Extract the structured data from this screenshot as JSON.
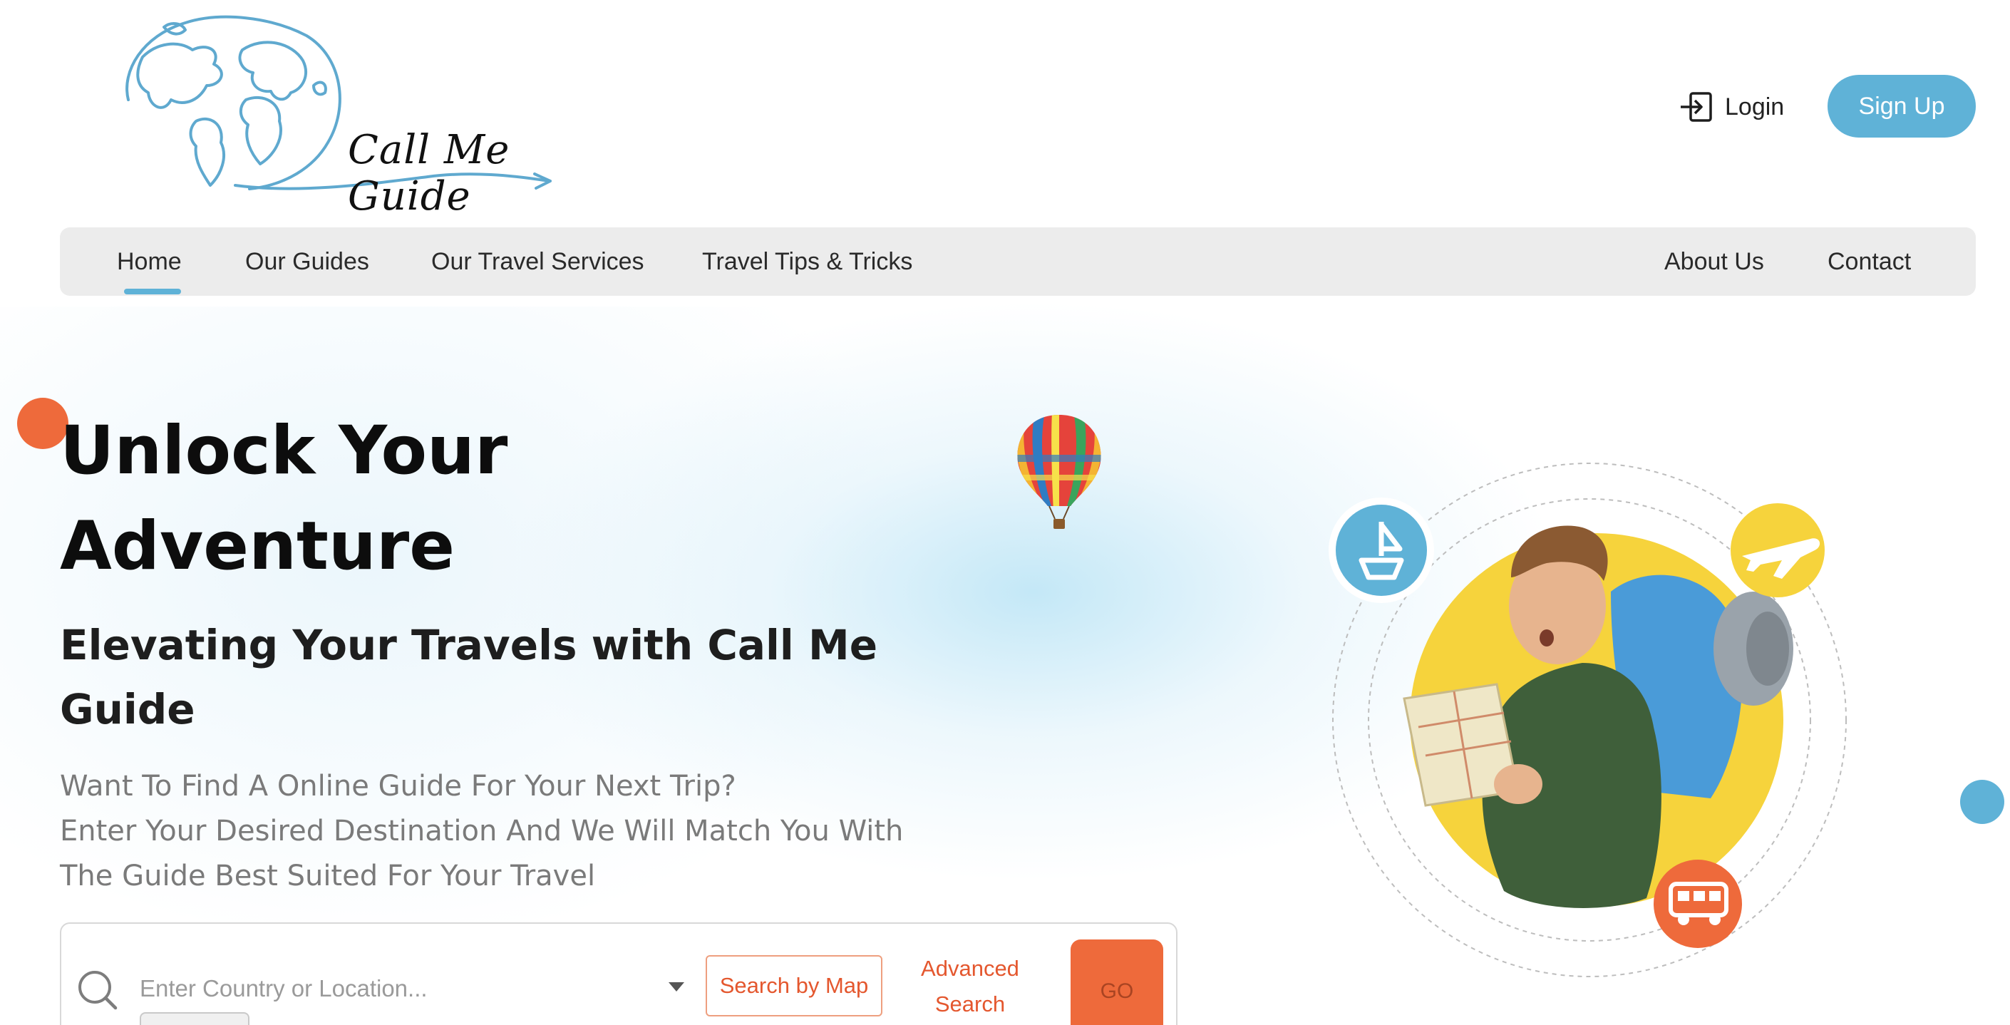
{
  "brand": {
    "name": "Call Me Guide",
    "accent": "#5fb2d7",
    "orange": "#ee6a3b"
  },
  "header": {
    "login_label": "Login",
    "signup_label": "Sign Up"
  },
  "nav": {
    "left_items": [
      {
        "label": "Home",
        "active": true
      },
      {
        "label": "Our Guides"
      },
      {
        "label": "Our Travel Services"
      },
      {
        "label": "Travel Tips & Tricks"
      }
    ],
    "right_items": [
      {
        "label": "About Us"
      },
      {
        "label": "Contact"
      }
    ]
  },
  "hero": {
    "title_line1": "Unlock Your",
    "title_line2": "Adventure",
    "subtitle_line1": "Elevating Your Travels with Call Me",
    "subtitle_line2": "Guide",
    "desc_line1": "Want To Find A Online Guide For Your Next Trip?",
    "desc_line2": "Enter Your Desired Destination And We Will Match You With",
    "desc_line3": "The Guide Best Suited For Your Travel"
  },
  "search": {
    "placeholder": "Enter Country or Location...",
    "map_button": "Search by Map",
    "advanced_line1": "Advanced",
    "advanced_line2": "Search",
    "go_label": "GO"
  },
  "icons": {
    "login": "login-icon",
    "search": "search-icon",
    "boat": "boat-icon",
    "plane": "plane-icon",
    "van": "van-icon",
    "balloon": "hot-air-balloon-icon",
    "globe": "globe-logo-icon"
  }
}
